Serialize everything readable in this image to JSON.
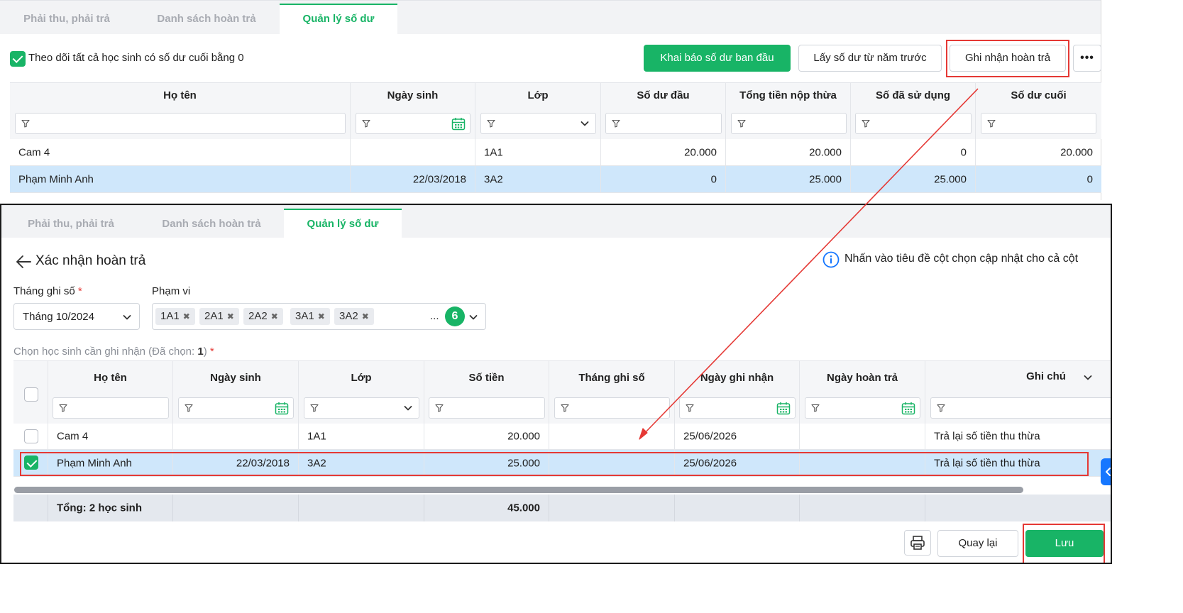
{
  "top": {
    "tabs": [
      "Phải thu, phải trả",
      "Danh sách hoàn trả",
      "Quản lý số dư"
    ],
    "active_tab": 2,
    "track_checkbox_label": "Theo dõi tất cả học sinh có số dư cuối bằng 0",
    "buttons": {
      "declare_initial": "Khai báo số dư ban đầu",
      "get_previous": "Lấy số dư từ năm trước",
      "record_refund": "Ghi nhận hoàn trả",
      "more": "•••"
    },
    "columns": [
      "Họ tên",
      "Ngày sinh",
      "Lớp",
      "Số dư đầu",
      "Tổng tiền nộp thừa",
      "Số đã sử dụng",
      "Số dư cuối"
    ],
    "rows": [
      {
        "name": "Cam 4",
        "dob": "",
        "class": "1A1",
        "opening": "20.000",
        "overpaid": "20.000",
        "used": "0",
        "closing": "20.000"
      },
      {
        "name": "Phạm Minh Anh",
        "dob": "22/03/2018",
        "class": "3A2",
        "opening": "0",
        "overpaid": "25.000",
        "used": "25.000",
        "closing": "0"
      }
    ]
  },
  "bottom": {
    "tabs": [
      "Phải thu, phải trả",
      "Danh sách hoàn trả",
      "Quản lý số dư"
    ],
    "title": "Xác nhận hoàn trả",
    "hint": "Nhấn vào tiêu đề cột chọn cập nhật cho cả cột",
    "month_label": "Tháng ghi số",
    "month_value": "Tháng 10/2024",
    "scope_label": "Phạm vi",
    "scope_chips": [
      "1A1",
      "2A1",
      "2A2",
      "3A1",
      "3A2"
    ],
    "scope_more": "...",
    "scope_count": "6",
    "select_label": "Chọn học sinh cần ghi nhận (Đã chọn: ",
    "select_count": "1",
    "select_label_end": ")",
    "required_mark": "*",
    "columns": [
      "Họ tên",
      "Ngày sinh",
      "Lớp",
      "Số tiền",
      "Tháng ghi số",
      "Ngày ghi nhận",
      "Ngày hoàn trả",
      "Ghi chú"
    ],
    "rows": [
      {
        "checked": false,
        "name": "Cam 4",
        "dob": "",
        "class": "1A1",
        "amount": "20.000",
        "month": "",
        "record_date": "25/06/2026",
        "refund_date": "",
        "note": "Trả lại số tiền thu thừa"
      },
      {
        "checked": true,
        "name": "Phạm Minh Anh",
        "dob": "22/03/2018",
        "class": "3A2",
        "amount": "25.000",
        "month": "",
        "record_date": "25/06/2026",
        "refund_date": "",
        "note": "Trả lại số tiền thu thừa"
      }
    ],
    "total_label": "Tổng: 2 học sinh",
    "total_amount": "45.000",
    "buttons": {
      "back": "Quay lại",
      "save": "Lưu"
    }
  },
  "colors": {
    "accent": "#18b466",
    "selected_row": "#cfe7fb",
    "annotation": "#e53935",
    "handle": "#1677ff"
  }
}
